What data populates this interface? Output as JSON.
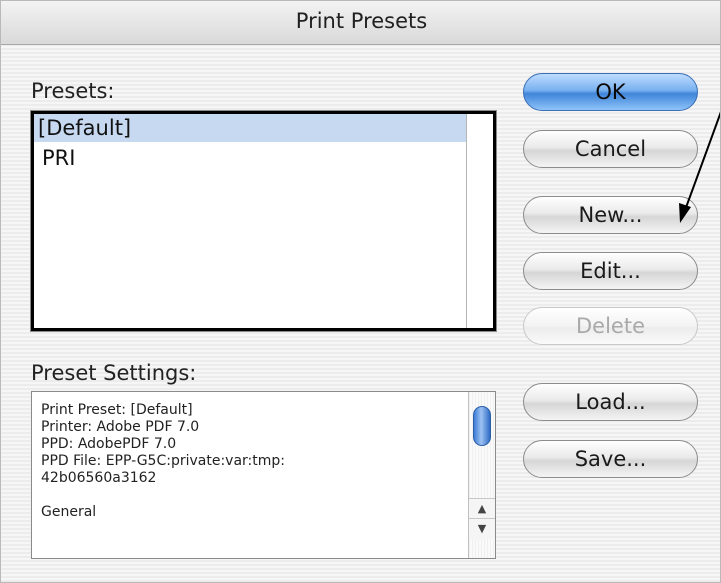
{
  "window": {
    "title": "Print Presets"
  },
  "presets": {
    "label": "Presets:",
    "items": [
      {
        "label": "[Default]",
        "selected": true
      },
      {
        "label": "PRI",
        "selected": false
      }
    ]
  },
  "settings": {
    "label": "Preset Settings:",
    "lines": [
      "Print Preset: [Default]",
      "Printer: Adobe PDF 7.0",
      "PPD: AdobePDF 7.0",
      "PPD File: EPP-G5C:private:var:tmp:",
      "42b06560a3162",
      "",
      "General"
    ]
  },
  "buttons": {
    "ok": "OK",
    "cancel": "Cancel",
    "new": "New...",
    "edit": "Edit...",
    "delete": "Delete",
    "load": "Load...",
    "save": "Save..."
  },
  "scrollbar": {
    "up_arrow": "▲",
    "down_arrow": "▼"
  },
  "colors": {
    "default_button": "#5a9ae6",
    "selection": "#c6d9f1"
  }
}
